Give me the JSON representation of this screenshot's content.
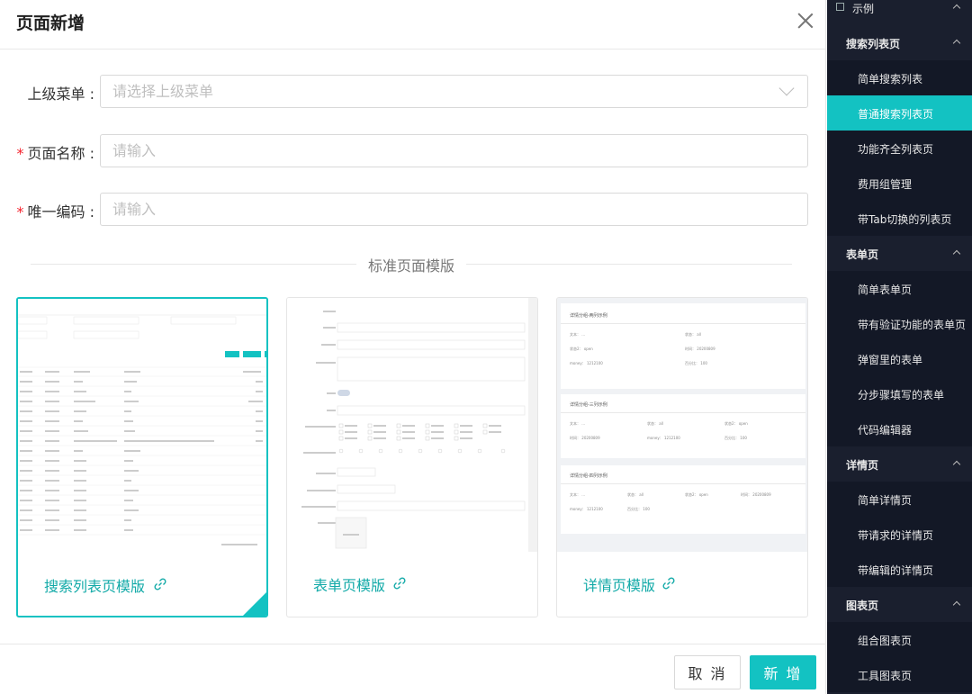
{
  "modal": {
    "title": "页面新增",
    "fields": {
      "parent_menu": {
        "label": "上级菜单 :",
        "placeholder": "请选择上级菜单",
        "required": false
      },
      "page_name": {
        "label": "页面名称 :",
        "placeholder": "请输入",
        "required": true
      },
      "unique_code": {
        "label": "唯一编码 :",
        "placeholder": "请输入",
        "required": true
      }
    },
    "divider_text": "标准页面模版",
    "templates": [
      {
        "caption": "搜索列表页模版",
        "selected": true
      },
      {
        "caption": "表单页模版",
        "selected": false
      },
      {
        "caption": "详情页模版",
        "selected": false
      }
    ],
    "footer": {
      "cancel_label": "取 消",
      "submit_label": "新 增"
    }
  },
  "sidebar": {
    "top_label": "示例",
    "items": [
      {
        "label": "搜索列表页",
        "type": "group"
      },
      {
        "label": "简单搜索列表",
        "type": "child"
      },
      {
        "label": "普通搜索列表页",
        "type": "child",
        "active": true
      },
      {
        "label": "功能齐全列表页",
        "type": "child"
      },
      {
        "label": "费用组管理",
        "type": "child"
      },
      {
        "label": "带Tab切换的列表页",
        "type": "child"
      },
      {
        "label": "表单页",
        "type": "group"
      },
      {
        "label": "简单表单页",
        "type": "child"
      },
      {
        "label": "带有验证功能的表单页",
        "type": "child"
      },
      {
        "label": "弹窗里的表单",
        "type": "child"
      },
      {
        "label": "分步骤填写的表单",
        "type": "child"
      },
      {
        "label": "代码编辑器",
        "type": "child"
      },
      {
        "label": "详情页",
        "type": "group"
      },
      {
        "label": "简单详情页",
        "type": "child"
      },
      {
        "label": "带请求的详情页",
        "type": "child"
      },
      {
        "label": "带编辑的详情页",
        "type": "child"
      },
      {
        "label": "图表页",
        "type": "group"
      },
      {
        "label": "组合图表页",
        "type": "child"
      },
      {
        "label": "工具图表页",
        "type": "child"
      }
    ]
  },
  "previews": {
    "detail": {
      "sections": [
        {
          "title": "详情分组-两列示例",
          "rows": [
            [
              "文本： ...",
              "状态： all"
            ],
            [
              "状态2： open",
              "时间： 20200809"
            ],
            [
              "money： 1212100",
              "百分比： 100"
            ]
          ]
        },
        {
          "title": "详情分组-三列示例",
          "rows": [
            [
              "文本： ...",
              "状态： all",
              "状态2： open"
            ],
            [
              "时间： 20200809",
              "money： 1212100",
              "百分比： 100"
            ]
          ]
        },
        {
          "title": "详情分组-四列示例",
          "rows": [
            [
              "文本： ...",
              "状态： all",
              "状态2： open",
              "时间： 20200809"
            ],
            [
              "money： 1212100",
              "百分比： 100"
            ]
          ]
        }
      ]
    }
  }
}
